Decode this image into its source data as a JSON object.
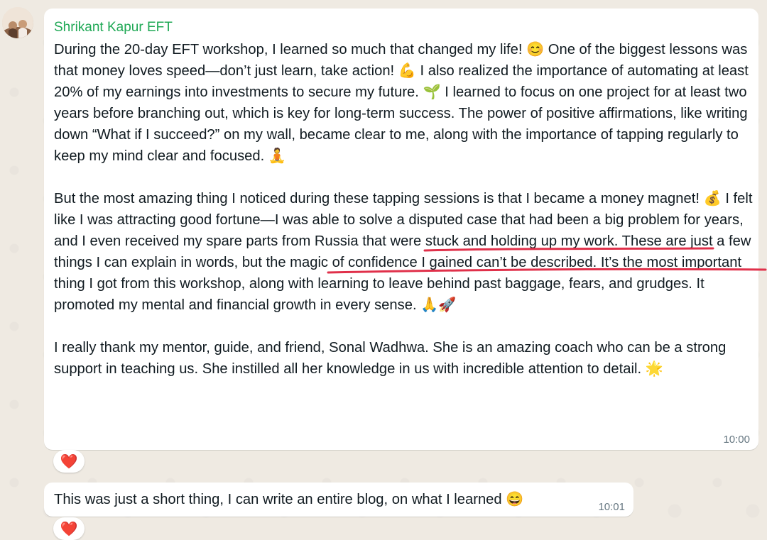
{
  "messages": [
    {
      "sender": "Shrikant Kapur EFT",
      "paragraphs": [
        "During the 20-day EFT workshop, I learned so much that changed my life! 😊 One of the biggest lessons was that money loves speed—don’t just learn, take action! 💪 I also realized the importance of automating at least 20% of my earnings into investments to secure my future. 🌱 I learned to focus on one project for at least two years before branching out, which is key for long-term success. The power of positive affirmations, like writing down “What if I succeed?” on my wall, became clear to me, along with the importance of tapping regularly to keep my mind clear and focused. 🧘",
        "But the most amazing thing I noticed during these tapping sessions is that I became a money magnet! 💰 I felt like I was attracting good fortune—I was able to solve a disputed case that had been a big problem for years, and I even received my spare parts from Russia that were stuck and holding up my work. These are just a few things I can explain in words, but the magic of confidence I gained can’t be described. It’s the most important thing I got from this workshop, along with learning to leave behind past baggage, fears, and grudges. It promoted my mental and financial growth in every sense. 🙏🚀",
        "I really thank my mentor, guide, and friend, Sonal Wadhwa. She is an amazing coach who can be a strong support in teaching us. She instilled all her knowledge in us with incredible attention to detail. 🌟"
      ],
      "time": "10:00",
      "reaction": "❤️"
    },
    {
      "text": "This was just a short thing, I can write an entire blog, on what I learned 😄",
      "time": "10:01",
      "reaction": "❤️"
    }
  ],
  "colors": {
    "sender_name": "#1fa855",
    "underline": "#e0304a",
    "chat_background": "#efeae2",
    "bubble": "#ffffff"
  },
  "icons": {
    "avatar": "user-avatar",
    "reaction": "heart-icon"
  }
}
